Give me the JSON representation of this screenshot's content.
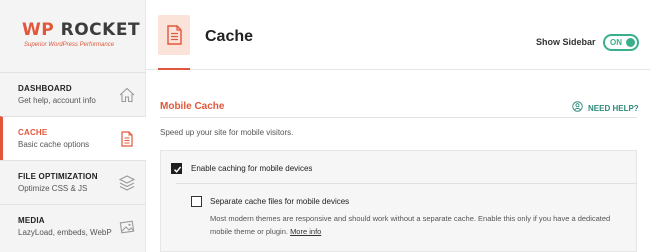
{
  "brand": {
    "logo_wp": "WP",
    "logo_rocket": "ROCKET",
    "tagline": "Superior WordPress Performance",
    "accent_color": "#e0573b"
  },
  "sidebar": {
    "items": [
      {
        "title": "DASHBOARD",
        "sub": "Get help, account info",
        "icon": "home-icon"
      },
      {
        "title": "CACHE",
        "sub": "Basic cache options",
        "icon": "document-icon",
        "active": true
      },
      {
        "title": "FILE OPTIMIZATION",
        "sub": "Optimize CSS & JS",
        "icon": "layers-icon"
      },
      {
        "title": "MEDIA",
        "sub": "LazyLoad, embeds, WebP",
        "icon": "image-icon"
      }
    ]
  },
  "header": {
    "title": "Cache",
    "show_sidebar_label": "Show Sidebar",
    "toggle_label": "ON",
    "toggle_color": "#3aaf8c"
  },
  "section": {
    "title": "Mobile Cache",
    "need_help": "NEED HELP?",
    "description": "Speed up your site for mobile visitors."
  },
  "options": {
    "enable_mobile": {
      "label": "Enable caching for mobile devices",
      "checked": true
    },
    "separate_files": {
      "label": "Separate cache files for mobile devices",
      "checked": false,
      "description": "Most modern themes are responsive and should work without a separate cache. Enable this only if you have a dedicated mobile theme or plugin.",
      "more_info": "More info"
    }
  }
}
